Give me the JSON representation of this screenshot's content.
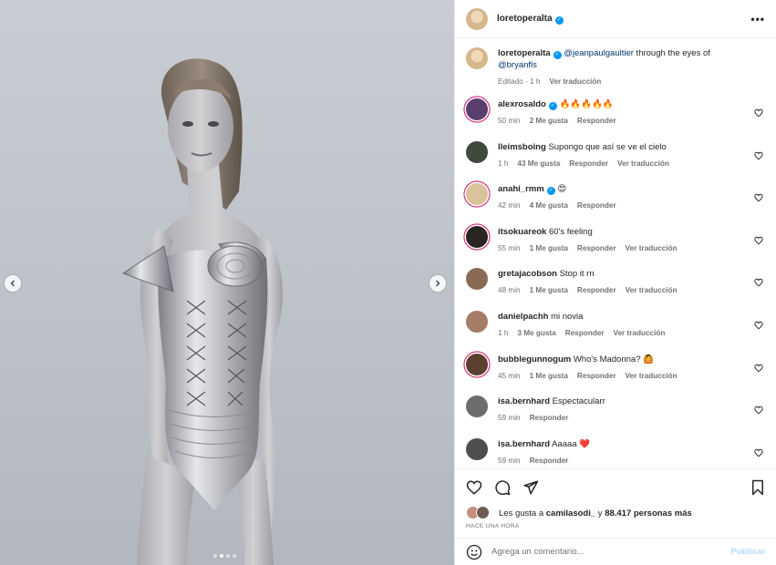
{
  "post": {
    "author": "loretoperalta",
    "author_verified": true,
    "carousel": {
      "slides": 4,
      "active_index": 1
    }
  },
  "caption": {
    "username": "loretoperalta",
    "mention": "@jeanpaulgaultier",
    "text": " through the eyes of",
    "mention2": "@bryanfls",
    "edited": "Editado · 1 h",
    "translate": "Ver traducción"
  },
  "comments": [
    {
      "username": "alexrosaldo",
      "verified": true,
      "text": "🔥🔥🔥🔥🔥",
      "time": "50 min",
      "likes": "2 Me gusta",
      "reply": "Responder",
      "translate": "",
      "avatar_color": "#5a3f6e",
      "story_ring": true
    },
    {
      "username": "lleimsboing",
      "verified": false,
      "text": "Supongo que así se ve el cielo",
      "time": "1 h",
      "likes": "43 Me gusta",
      "reply": "Responder",
      "translate": "Ver traducción",
      "avatar_color": "#3f4a3a",
      "story_ring": false
    },
    {
      "username": "anahi_rmm",
      "verified": true,
      "text": "😍",
      "time": "42 min",
      "likes": "4 Me gusta",
      "reply": "Responder",
      "translate": "",
      "avatar_color": "#d8c39a",
      "story_ring": true
    },
    {
      "username": "itsokuareok",
      "verified": false,
      "text": "60's feeling",
      "time": "55 min",
      "likes": "1 Me gusta",
      "reply": "Responder",
      "translate": "Ver traducción",
      "avatar_color": "#2a2522",
      "story_ring": true
    },
    {
      "username": "gretajacobson",
      "verified": false,
      "text": "Stop it rn",
      "time": "48 min",
      "likes": "1 Me gusta",
      "reply": "Responder",
      "translate": "Ver traducción",
      "avatar_color": "#8a6a55",
      "story_ring": false
    },
    {
      "username": "danielpachh",
      "verified": false,
      "text": "mi novia",
      "time": "1 h",
      "likes": "3 Me gusta",
      "reply": "Responder",
      "translate": "Ver traducción",
      "avatar_color": "#a57c66",
      "story_ring": false
    },
    {
      "username": "bubblegunnogum",
      "verified": false,
      "text": "Who's Madonna? 🙆",
      "time": "45 min",
      "likes": "1 Me gusta",
      "reply": "Responder",
      "translate": "Ver traducción",
      "avatar_color": "#5b4030",
      "story_ring": true
    },
    {
      "username": "isa.bernhard",
      "verified": false,
      "text": "Espectacularr",
      "time": "59 min",
      "likes": "",
      "reply": "Responder",
      "translate": "",
      "avatar_color": "#6d6d6d",
      "story_ring": false
    },
    {
      "username": "isa.bernhard",
      "verified": false,
      "text": "Aaaaa ❤️",
      "time": "59 min",
      "likes": "",
      "reply": "Responder",
      "translate": "",
      "avatar_color": "#4e4e4e",
      "story_ring": false
    }
  ],
  "likes": {
    "prefix": "Les gusta a ",
    "user": "camilasodi_",
    "middle": " y ",
    "count": "88.417 personas más"
  },
  "posted_ago": "HACE UNA HORA",
  "composer": {
    "placeholder": "Agrega un comentario...",
    "publish_label": "Publicar"
  },
  "colors": {
    "link": "#00376b",
    "verified": "#0095f6",
    "muted": "#737373",
    "story_ring": "#d62976"
  },
  "icons": [
    "chevron-left-icon",
    "chevron-right-icon",
    "more-icon",
    "heart-icon",
    "comment-icon",
    "share-icon",
    "bookmark-icon",
    "emoji-icon",
    "verified-icon"
  ]
}
